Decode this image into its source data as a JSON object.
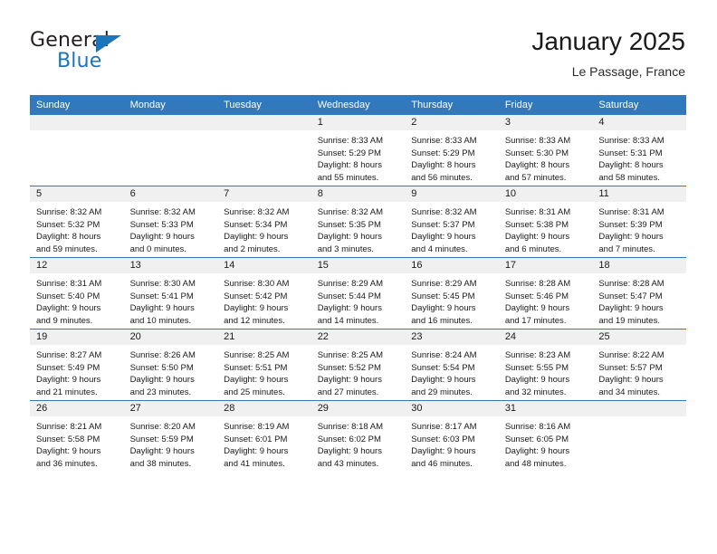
{
  "brand": {
    "name_top": "General",
    "name_bottom": "Blue",
    "triangle_color": "#1b75bb"
  },
  "header": {
    "title": "January 2025",
    "subtitle": "Le Passage, France"
  },
  "theme": {
    "header_blue": "#3179bc",
    "daynum_band": "#f0f0f0",
    "text": "#1a1a1a"
  },
  "calendar": {
    "weekday_headers": [
      "Sunday",
      "Monday",
      "Tuesday",
      "Wednesday",
      "Thursday",
      "Friday",
      "Saturday"
    ],
    "weeks": [
      [
        {
          "day": "",
          "lines": []
        },
        {
          "day": "",
          "lines": []
        },
        {
          "day": "",
          "lines": []
        },
        {
          "day": "1",
          "lines": [
            "Sunrise: 8:33 AM",
            "Sunset: 5:29 PM",
            "Daylight: 8 hours",
            "and 55 minutes."
          ]
        },
        {
          "day": "2",
          "lines": [
            "Sunrise: 8:33 AM",
            "Sunset: 5:29 PM",
            "Daylight: 8 hours",
            "and 56 minutes."
          ]
        },
        {
          "day": "3",
          "lines": [
            "Sunrise: 8:33 AM",
            "Sunset: 5:30 PM",
            "Daylight: 8 hours",
            "and 57 minutes."
          ]
        },
        {
          "day": "4",
          "lines": [
            "Sunrise: 8:33 AM",
            "Sunset: 5:31 PM",
            "Daylight: 8 hours",
            "and 58 minutes."
          ]
        }
      ],
      [
        {
          "day": "5",
          "lines": [
            "Sunrise: 8:32 AM",
            "Sunset: 5:32 PM",
            "Daylight: 8 hours",
            "and 59 minutes."
          ]
        },
        {
          "day": "6",
          "lines": [
            "Sunrise: 8:32 AM",
            "Sunset: 5:33 PM",
            "Daylight: 9 hours",
            "and 0 minutes."
          ]
        },
        {
          "day": "7",
          "lines": [
            "Sunrise: 8:32 AM",
            "Sunset: 5:34 PM",
            "Daylight: 9 hours",
            "and 2 minutes."
          ]
        },
        {
          "day": "8",
          "lines": [
            "Sunrise: 8:32 AM",
            "Sunset: 5:35 PM",
            "Daylight: 9 hours",
            "and 3 minutes."
          ]
        },
        {
          "day": "9",
          "lines": [
            "Sunrise: 8:32 AM",
            "Sunset: 5:37 PM",
            "Daylight: 9 hours",
            "and 4 minutes."
          ]
        },
        {
          "day": "10",
          "lines": [
            "Sunrise: 8:31 AM",
            "Sunset: 5:38 PM",
            "Daylight: 9 hours",
            "and 6 minutes."
          ]
        },
        {
          "day": "11",
          "lines": [
            "Sunrise: 8:31 AM",
            "Sunset: 5:39 PM",
            "Daylight: 9 hours",
            "and 7 minutes."
          ]
        }
      ],
      [
        {
          "day": "12",
          "lines": [
            "Sunrise: 8:31 AM",
            "Sunset: 5:40 PM",
            "Daylight: 9 hours",
            "and 9 minutes."
          ]
        },
        {
          "day": "13",
          "lines": [
            "Sunrise: 8:30 AM",
            "Sunset: 5:41 PM",
            "Daylight: 9 hours",
            "and 10 minutes."
          ]
        },
        {
          "day": "14",
          "lines": [
            "Sunrise: 8:30 AM",
            "Sunset: 5:42 PM",
            "Daylight: 9 hours",
            "and 12 minutes."
          ]
        },
        {
          "day": "15",
          "lines": [
            "Sunrise: 8:29 AM",
            "Sunset: 5:44 PM",
            "Daylight: 9 hours",
            "and 14 minutes."
          ]
        },
        {
          "day": "16",
          "lines": [
            "Sunrise: 8:29 AM",
            "Sunset: 5:45 PM",
            "Daylight: 9 hours",
            "and 16 minutes."
          ]
        },
        {
          "day": "17",
          "lines": [
            "Sunrise: 8:28 AM",
            "Sunset: 5:46 PM",
            "Daylight: 9 hours",
            "and 17 minutes."
          ]
        },
        {
          "day": "18",
          "lines": [
            "Sunrise: 8:28 AM",
            "Sunset: 5:47 PM",
            "Daylight: 9 hours",
            "and 19 minutes."
          ]
        }
      ],
      [
        {
          "day": "19",
          "lines": [
            "Sunrise: 8:27 AM",
            "Sunset: 5:49 PM",
            "Daylight: 9 hours",
            "and 21 minutes."
          ]
        },
        {
          "day": "20",
          "lines": [
            "Sunrise: 8:26 AM",
            "Sunset: 5:50 PM",
            "Daylight: 9 hours",
            "and 23 minutes."
          ]
        },
        {
          "day": "21",
          "lines": [
            "Sunrise: 8:25 AM",
            "Sunset: 5:51 PM",
            "Daylight: 9 hours",
            "and 25 minutes."
          ]
        },
        {
          "day": "22",
          "lines": [
            "Sunrise: 8:25 AM",
            "Sunset: 5:52 PM",
            "Daylight: 9 hours",
            "and 27 minutes."
          ]
        },
        {
          "day": "23",
          "lines": [
            "Sunrise: 8:24 AM",
            "Sunset: 5:54 PM",
            "Daylight: 9 hours",
            "and 29 minutes."
          ]
        },
        {
          "day": "24",
          "lines": [
            "Sunrise: 8:23 AM",
            "Sunset: 5:55 PM",
            "Daylight: 9 hours",
            "and 32 minutes."
          ]
        },
        {
          "day": "25",
          "lines": [
            "Sunrise: 8:22 AM",
            "Sunset: 5:57 PM",
            "Daylight: 9 hours",
            "and 34 minutes."
          ]
        }
      ],
      [
        {
          "day": "26",
          "lines": [
            "Sunrise: 8:21 AM",
            "Sunset: 5:58 PM",
            "Daylight: 9 hours",
            "and 36 minutes."
          ]
        },
        {
          "day": "27",
          "lines": [
            "Sunrise: 8:20 AM",
            "Sunset: 5:59 PM",
            "Daylight: 9 hours",
            "and 38 minutes."
          ]
        },
        {
          "day": "28",
          "lines": [
            "Sunrise: 8:19 AM",
            "Sunset: 6:01 PM",
            "Daylight: 9 hours",
            "and 41 minutes."
          ]
        },
        {
          "day": "29",
          "lines": [
            "Sunrise: 8:18 AM",
            "Sunset: 6:02 PM",
            "Daylight: 9 hours",
            "and 43 minutes."
          ]
        },
        {
          "day": "30",
          "lines": [
            "Sunrise: 8:17 AM",
            "Sunset: 6:03 PM",
            "Daylight: 9 hours",
            "and 46 minutes."
          ]
        },
        {
          "day": "31",
          "lines": [
            "Sunrise: 8:16 AM",
            "Sunset: 6:05 PM",
            "Daylight: 9 hours",
            "and 48 minutes."
          ]
        },
        {
          "day": "",
          "lines": []
        }
      ]
    ]
  }
}
